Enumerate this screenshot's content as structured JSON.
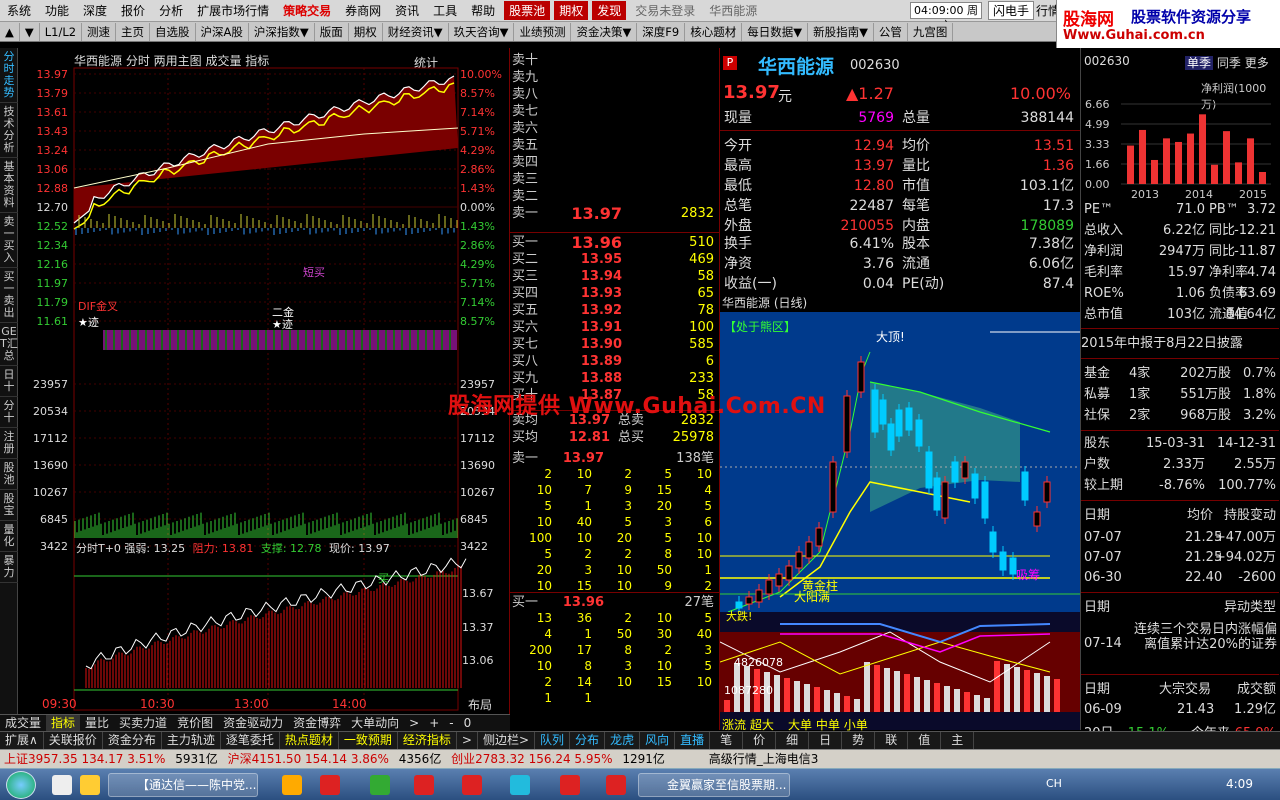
{
  "menubar": {
    "items": [
      "系统",
      "功能",
      "深度",
      "报价",
      "分析",
      "扩展市场行情",
      "策略交易",
      "券商网",
      "资讯",
      "工具",
      "帮助"
    ],
    "tags": [
      "股票池",
      "期权",
      "发现"
    ],
    "login": "交易未登录",
    "stock": "华西能源",
    "clock": "04:09:00",
    "weekday": "周六",
    "right": [
      "闪电手",
      "行情"
    ]
  },
  "toolbar": {
    "items": [
      "▲",
      "▼",
      "L1/L2",
      "测速",
      "主页",
      "自选股",
      "沪深A股",
      "沪深指数▼",
      "版面",
      "期权",
      "财经资讯▼",
      "玖天咨询▼",
      "业绩预测",
      "资金决策▼",
      "深度F9",
      "核心题材",
      "每日数据▼",
      "新股指南▼",
      "公管",
      "九宫图"
    ]
  },
  "watermark": {
    "line1": "股海网",
    "line1b": "股票软件资源分享",
    "line2": "Www.Guhai.com.cn",
    "overlay": "股海网提供 Www.Guhai.Com.CN"
  },
  "lefttabs": [
    "分时走势",
    "技术分析",
    "基本资料",
    "卖一买入",
    "买一卖出",
    "GET汇总",
    "日十",
    "分十",
    "注册",
    "股池",
    "股宝",
    "量化",
    "暴力"
  ],
  "minute": {
    "title": "华西能源  分时  两用主图  成交量  指标",
    "stat": "统计",
    "left_prices": [
      "13.97",
      "13.79",
      "13.61",
      "13.43",
      "13.24",
      "13.06",
      "12.88",
      "12.70",
      "12.52",
      "12.34",
      "12.16",
      "11.97",
      "11.79",
      "11.61"
    ],
    "right_pcts": [
      "10.00%",
      "8.57%",
      "7.14%",
      "5.71%",
      "4.29%",
      "2.86%",
      "1.43%",
      "0.00%",
      "1.43%",
      "2.86%",
      "4.29%",
      "5.71%",
      "7.14%",
      "8.57%"
    ],
    "vol_labels": [
      "23957",
      "20534",
      "17112",
      "13690",
      "10267",
      "6845",
      "3422"
    ],
    "t0_title": "分时T+0 强弱: 13.25",
    "t0_zl": "阻力: 13.81",
    "t0_zc": "支撑: 12.78",
    "t0_xj": "现价: 13.97",
    "t0_right": [
      "13.67",
      "13.37",
      "13.06"
    ],
    "times": [
      "09:30",
      "10:30",
      "13:00",
      "14:00"
    ],
    "layout": "布局",
    "dif": "DIF金叉",
    "ji": "★迹",
    "ji2": "★迹",
    "erjin": "二金",
    "duanmai": "短买",
    "buy_lbl": "买"
  },
  "book": {
    "sells": [
      "卖十",
      "卖九",
      "卖八",
      "卖七",
      "卖六",
      "卖五",
      "卖四",
      "卖三",
      "卖二",
      "卖一"
    ],
    "sell1": {
      "price": "13.97",
      "vol": "2832"
    },
    "buys": [
      {
        "k": "买一",
        "p": "13.96",
        "v": "510"
      },
      {
        "k": "买二",
        "p": "13.95",
        "v": "469"
      },
      {
        "k": "买三",
        "p": "13.94",
        "v": "58"
      },
      {
        "k": "买四",
        "p": "13.93",
        "v": "65"
      },
      {
        "k": "买五",
        "p": "13.92",
        "v": "78"
      },
      {
        "k": "买六",
        "p": "13.91",
        "v": "100"
      },
      {
        "k": "买七",
        "p": "13.90",
        "v": "585"
      },
      {
        "k": "买八",
        "p": "13.89",
        "v": "6"
      },
      {
        "k": "买九",
        "p": "13.88",
        "v": "233"
      },
      {
        "k": "买十",
        "p": "13.87",
        "v": "58"
      }
    ],
    "sj": {
      "k": "卖均",
      "p": "13.97",
      "t": "总卖",
      "v": "2832"
    },
    "bj": {
      "k": "买均",
      "p": "12.81",
      "t": "总买",
      "v": "25978"
    },
    "s1q": {
      "k": "卖一",
      "p": "13.97",
      "v": "138笔"
    },
    "s1grid": [
      [
        "2",
        "10",
        "2",
        "5",
        "10"
      ],
      [
        "10",
        "7",
        "9",
        "15",
        "4"
      ],
      [
        "5",
        "1",
        "3",
        "20",
        "5"
      ],
      [
        "10",
        "40",
        "5",
        "3",
        "6"
      ],
      [
        "100",
        "10",
        "20",
        "5",
        "10"
      ],
      [
        "5",
        "2",
        "2",
        "8",
        "10"
      ],
      [
        "20",
        "3",
        "10",
        "50",
        "1"
      ],
      [
        "10",
        "15",
        "10",
        "9",
        "2"
      ]
    ],
    "b1q": {
      "k": "买一",
      "p": "13.96",
      "v": "27笔"
    },
    "b1grid": [
      [
        "13",
        "36",
        "2",
        "10",
        "5"
      ],
      [
        "4",
        "1",
        "50",
        "30",
        "40"
      ],
      [
        "200",
        "17",
        "8",
        "2",
        "3"
      ],
      [
        "10",
        "8",
        "3",
        "10",
        "5"
      ],
      [
        "2",
        "14",
        "10",
        "15",
        "10"
      ],
      [
        "1",
        "1",
        "",
        "",
        ""
      ]
    ]
  },
  "quote": {
    "flag": "P",
    "name": "华西能源",
    "code": "002630",
    "price": "13.97",
    "unit": "元",
    "change": "▲1.27",
    "pct": "10.00%",
    "rows": [
      [
        "现量",
        "5769",
        "总量",
        "388144"
      ],
      [
        "今开",
        "12.94",
        "均价",
        "13.51"
      ],
      [
        "最高",
        "13.97",
        "量比",
        "1.36"
      ],
      [
        "最低",
        "12.80",
        "市值",
        "103.1亿"
      ],
      [
        "总笔",
        "22487",
        "每笔",
        "17.3"
      ],
      [
        "外盘",
        "210055",
        "内盘",
        "178089"
      ],
      [
        "换手",
        "6.41%",
        "股本",
        "7.38亿"
      ],
      [
        "净资",
        "3.76",
        "流通",
        "6.06亿"
      ],
      [
        "收益(一)",
        "0.04",
        "PE(动)",
        "87.4"
      ]
    ]
  },
  "daily": {
    "title": "华西能源 (日线)",
    "zone": "【处于熊区】",
    "dading": "大顶!",
    "jinzhu": "黄金柱",
    "dadie": "大跌!",
    "dafan": "大阳满",
    "xiancai": "吸筹",
    "labels": [
      "4826078",
      "1087280"
    ],
    "dan": [
      "大单",
      "中单",
      "小单"
    ],
    "bottom": [
      "涨流",
      "超大"
    ]
  },
  "fin": {
    "code": "002630",
    "tabs": [
      "单季",
      "同季",
      "更多"
    ],
    "chart_title": "净利润(1000万)",
    "y_ticks": [
      "6.66",
      "4.99",
      "3.33",
      "1.66",
      "0.00"
    ],
    "years": [
      "2013",
      "2014",
      "2015"
    ],
    "chart_data": {
      "type": "bar",
      "values": [
        3.2,
        4.5,
        2.0,
        3.8,
        3.5,
        4.2,
        5.8,
        1.6,
        4.4,
        1.8,
        3.8,
        1.0
      ],
      "ylim": [
        0,
        6.66
      ]
    },
    "rows1": [
      [
        "PE™",
        "71.0",
        "PB™",
        "3.72"
      ],
      [
        "总收入",
        "6.22亿",
        "同比",
        "-12.21"
      ],
      [
        "净利润",
        "2947万",
        "同比",
        "-11.87"
      ],
      [
        "毛利率",
        "15.97",
        "净利率",
        "4.74"
      ],
      [
        "ROE%",
        "1.06",
        "负债率",
        "63.69"
      ],
      [
        "总市值",
        "103亿",
        "流通值",
        "84.64亿"
      ]
    ],
    "report": "2015年中报于8月22日披露",
    "rows2": [
      [
        "基金",
        "4家",
        "202万股",
        "0.7%"
      ],
      [
        "私募",
        "1家",
        "551万股",
        "1.8%"
      ],
      [
        "社保",
        "2家",
        "968万股",
        "3.2%"
      ]
    ],
    "rows3": [
      [
        "股东",
        "15-03-31",
        "",
        "14-12-31"
      ],
      [
        "户数",
        "2.33万",
        "",
        "2.55万"
      ],
      [
        "较上期",
        "-8.76%",
        "",
        "100.77%"
      ]
    ],
    "rows4h": [
      "日期",
      "均价",
      "持股变动"
    ],
    "rows4": [
      [
        "07-07",
        "21.25",
        "+47.00万"
      ],
      [
        "07-07",
        "21.25",
        "+94.02万"
      ],
      [
        "06-30",
        "22.40",
        "-2600"
      ]
    ],
    "rows5h": [
      "日期",
      "异动类型"
    ],
    "rows5": [
      "07-14",
      "连续三个交易日内涨幅偏离值累计达20%的证券"
    ],
    "rows6h": [
      "日期",
      "大宗交易",
      "成交额"
    ],
    "rows6": [
      "06-09",
      "21.43",
      "1.29亿"
    ],
    "rows7": [
      "20日",
      "-15.1%",
      "今年来",
      "65.9%"
    ]
  },
  "btabs1": [
    "成交量",
    "指标",
    "量比",
    "买卖力道",
    "竞价图",
    "资金驱动力",
    "资金博弈",
    "大单动向",
    ">",
    "+",
    "-",
    "0"
  ],
  "btabs2": [
    "扩展∧",
    "关联报价",
    "资金分布",
    "主力轨迹",
    "逐笔委托",
    "热点题材",
    "一致预期",
    "经济指标",
    ">",
    "侧边栏>",
    "队列",
    "分布",
    "龙虎",
    "风向",
    "直播",
    "笔",
    "价",
    "细",
    "日",
    "势",
    "联",
    "值",
    "主"
  ],
  "status": {
    "sh": "上证3957.35  134.17  3.51%",
    "sh_amt": "5931亿",
    "hs": "沪深4151.50  154.14  3.86%",
    "hs_amt": "4356亿",
    "cy": "创业2783.32  156.24  5.95%",
    "cy_amt": "1291亿",
    "feed": "高级行情_上海电信3"
  },
  "taskbar": {
    "tasks": [
      "【通达信——陈中党...",
      "金翼赢家至信股票期..."
    ],
    "time": "4:09",
    "lang": "CH"
  },
  "colors": {
    "up": "#ff3232",
    "down": "#00cc00",
    "even": "#dddddd",
    "yellow": "#ffff00"
  }
}
